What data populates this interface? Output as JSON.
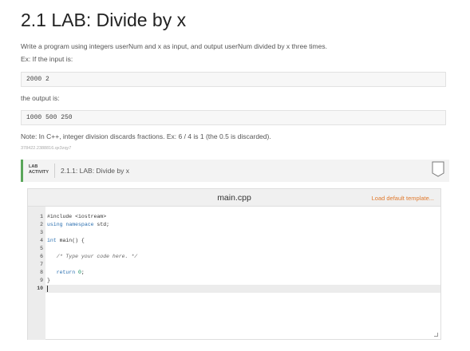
{
  "page": {
    "title": "2.1 LAB: Divide by x",
    "description": "Write a program using integers userNum and x as input, and output userNum divided by x three times.",
    "example_intro": "Ex: If the input is:",
    "example_input": "2000 2",
    "output_intro": "the output is:",
    "example_output": "1000 500 250",
    "note": "Note: In C++, integer division discards fractions. Ex: 6 / 4 is 1 (the 0.5 is discarded).",
    "small_id": "378422.2388816.qx3zqy7"
  },
  "activity": {
    "type_line1": "LAB",
    "type_line2": "ACTIVITY",
    "title": "2.1.1: LAB: Divide by x"
  },
  "editor": {
    "filename": "main.cpp",
    "load_template": "Load default template...",
    "lines": [
      {
        "n": "1",
        "code": "#include <iostream>"
      },
      {
        "n": "2",
        "code": "using namespace std;"
      },
      {
        "n": "3",
        "code": ""
      },
      {
        "n": "4",
        "code": "int main() {"
      },
      {
        "n": "5",
        "code": ""
      },
      {
        "n": "6",
        "code": "   /* Type your code here. */"
      },
      {
        "n": "7",
        "code": ""
      },
      {
        "n": "8",
        "code": "   return 0;"
      },
      {
        "n": "9",
        "code": "}"
      },
      {
        "n": "10",
        "code": ""
      }
    ]
  },
  "colors": {
    "accent_green": "#5aa65a",
    "link_orange": "#e07a2e"
  }
}
